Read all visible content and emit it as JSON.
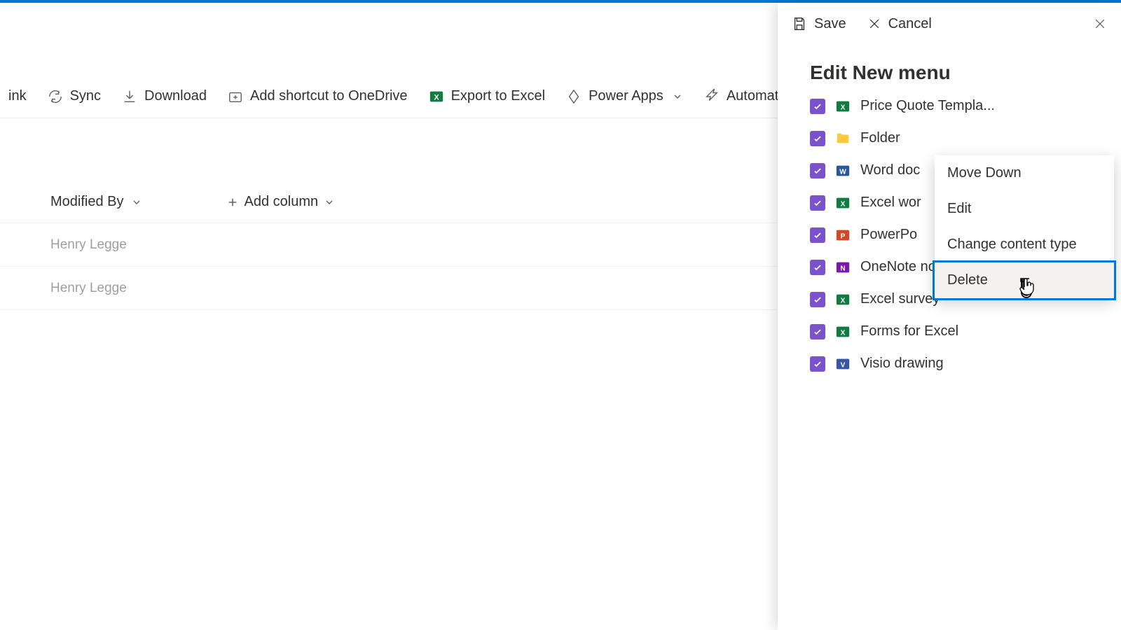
{
  "toolbar": {
    "link": "ink",
    "sync": "Sync",
    "download": "Download",
    "addShortcut": "Add shortcut to OneDrive",
    "export": "Export to Excel",
    "powerApps": "Power Apps",
    "automate": "Automate"
  },
  "columns": {
    "modifiedBy": "Modified By",
    "addColumn": "Add column"
  },
  "rows": [
    {
      "modifiedBy": "Henry Legge"
    },
    {
      "modifiedBy": "Henry Legge"
    }
  ],
  "panel": {
    "save": "Save",
    "cancel": "Cancel",
    "title": "Edit New menu",
    "items": [
      {
        "label": "Price Quote Templa...",
        "icon": "excel"
      },
      {
        "label": "Folder",
        "icon": "folder"
      },
      {
        "label": "Word doc",
        "icon": "word"
      },
      {
        "label": "Excel wor",
        "icon": "excel"
      },
      {
        "label": "PowerPo",
        "icon": "powerpoint"
      },
      {
        "label": "OneNote notebook",
        "icon": "onenote"
      },
      {
        "label": "Excel survey",
        "icon": "excel"
      },
      {
        "label": "Forms for Excel",
        "icon": "excel"
      },
      {
        "label": "Visio drawing",
        "icon": "visio"
      }
    ]
  },
  "contextMenu": {
    "moveDown": "Move Down",
    "edit": "Edit",
    "changeType": "Change content type",
    "delete": "Delete"
  }
}
